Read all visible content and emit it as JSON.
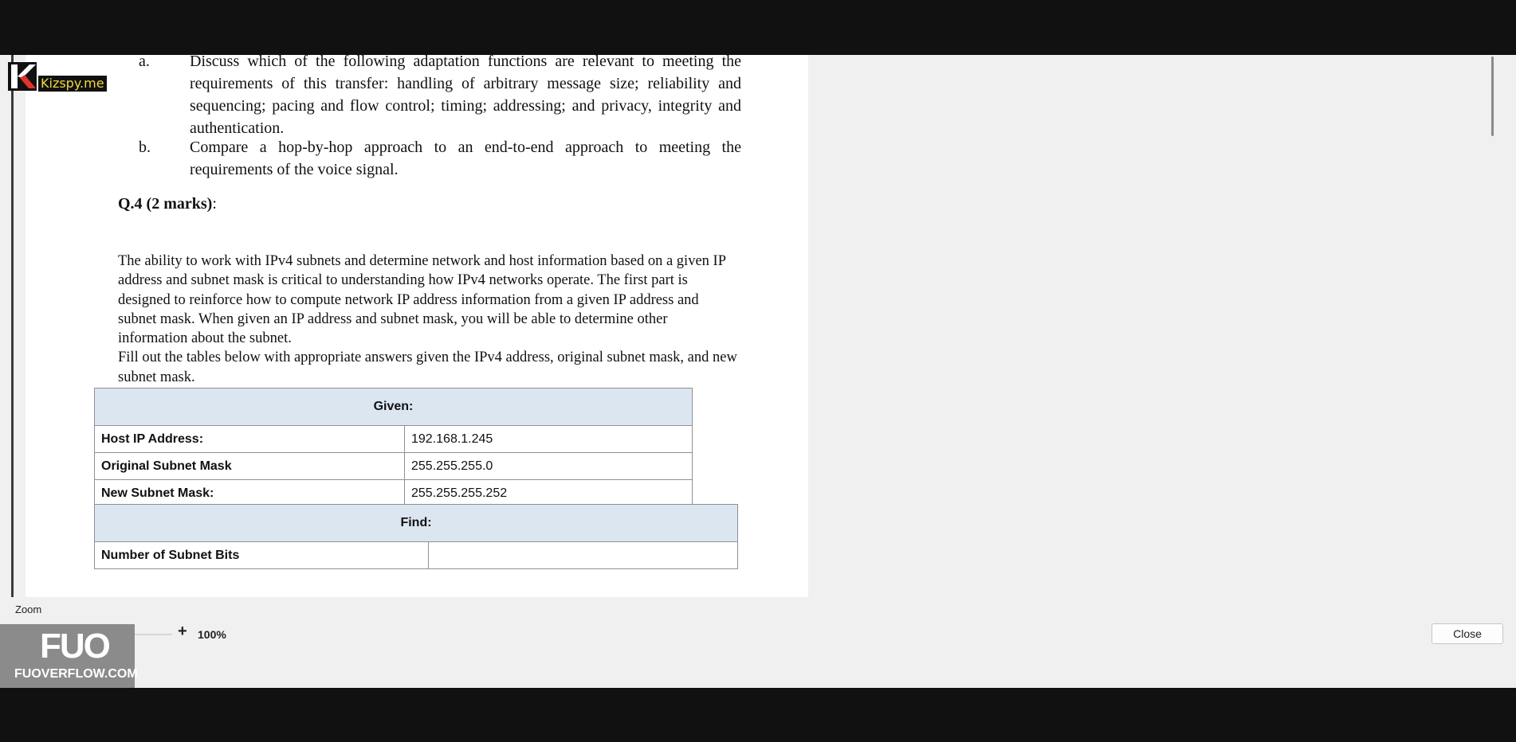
{
  "document": {
    "q3": {
      "item_a": {
        "marker": "a.",
        "text": "Discuss which of the following adaptation functions are relevant to meeting the requirements of this transfer: handling of arbitrary message size; reliability and sequencing; pacing and flow control; timing; addressing; and privacy, integrity and authentication."
      },
      "item_b": {
        "marker": "b.",
        "text": "Compare a hop-by-hop approach to an end-to-end approach to meeting the requirements of the voice signal."
      }
    },
    "q4": {
      "heading_bold": "Q.4 (2 marks)",
      "heading_suffix": ":",
      "intro_p1": "The ability to work with IPv4 subnets and determine network and host information based on a given IP address and subnet mask is critical to understanding how IPv4 networks operate. The first part is designed to reinforce how to compute network IP address information from a given IP address and subnet mask. When given an IP address and subnet mask, you will be able to determine other information about the subnet.",
      "intro_p2": "Fill out the tables below with appropriate answers given the IPv4 address, original subnet mask, and new subnet mask."
    },
    "given_table": {
      "header": "Given:",
      "rows": [
        {
          "label": "Host IP Address:",
          "value": "192.168.1.245"
        },
        {
          "label": "Original Subnet Mask",
          "value": "255.255.255.0"
        },
        {
          "label": "New Subnet Mask:",
          "value": "255.255.255.252"
        }
      ]
    },
    "find_table": {
      "header": "Find:",
      "rows": [
        {
          "label": "Number of Subnet Bits",
          "value": ""
        }
      ]
    }
  },
  "watermarks": {
    "kizspy": "Kizspy.me",
    "fuo_mark": "FUO",
    "fuo_text": "FUOVERFLOW.COM"
  },
  "zoom": {
    "label": "Zoom",
    "minus": "-",
    "plus": "+",
    "value_text": "100%",
    "level_percent": 100
  },
  "close_label": "Close",
  "colors": {
    "table_header_bg": "#dce6f1",
    "zoom_thumb": "#1f5a9e",
    "kizspy_text": "#f0d83a"
  }
}
